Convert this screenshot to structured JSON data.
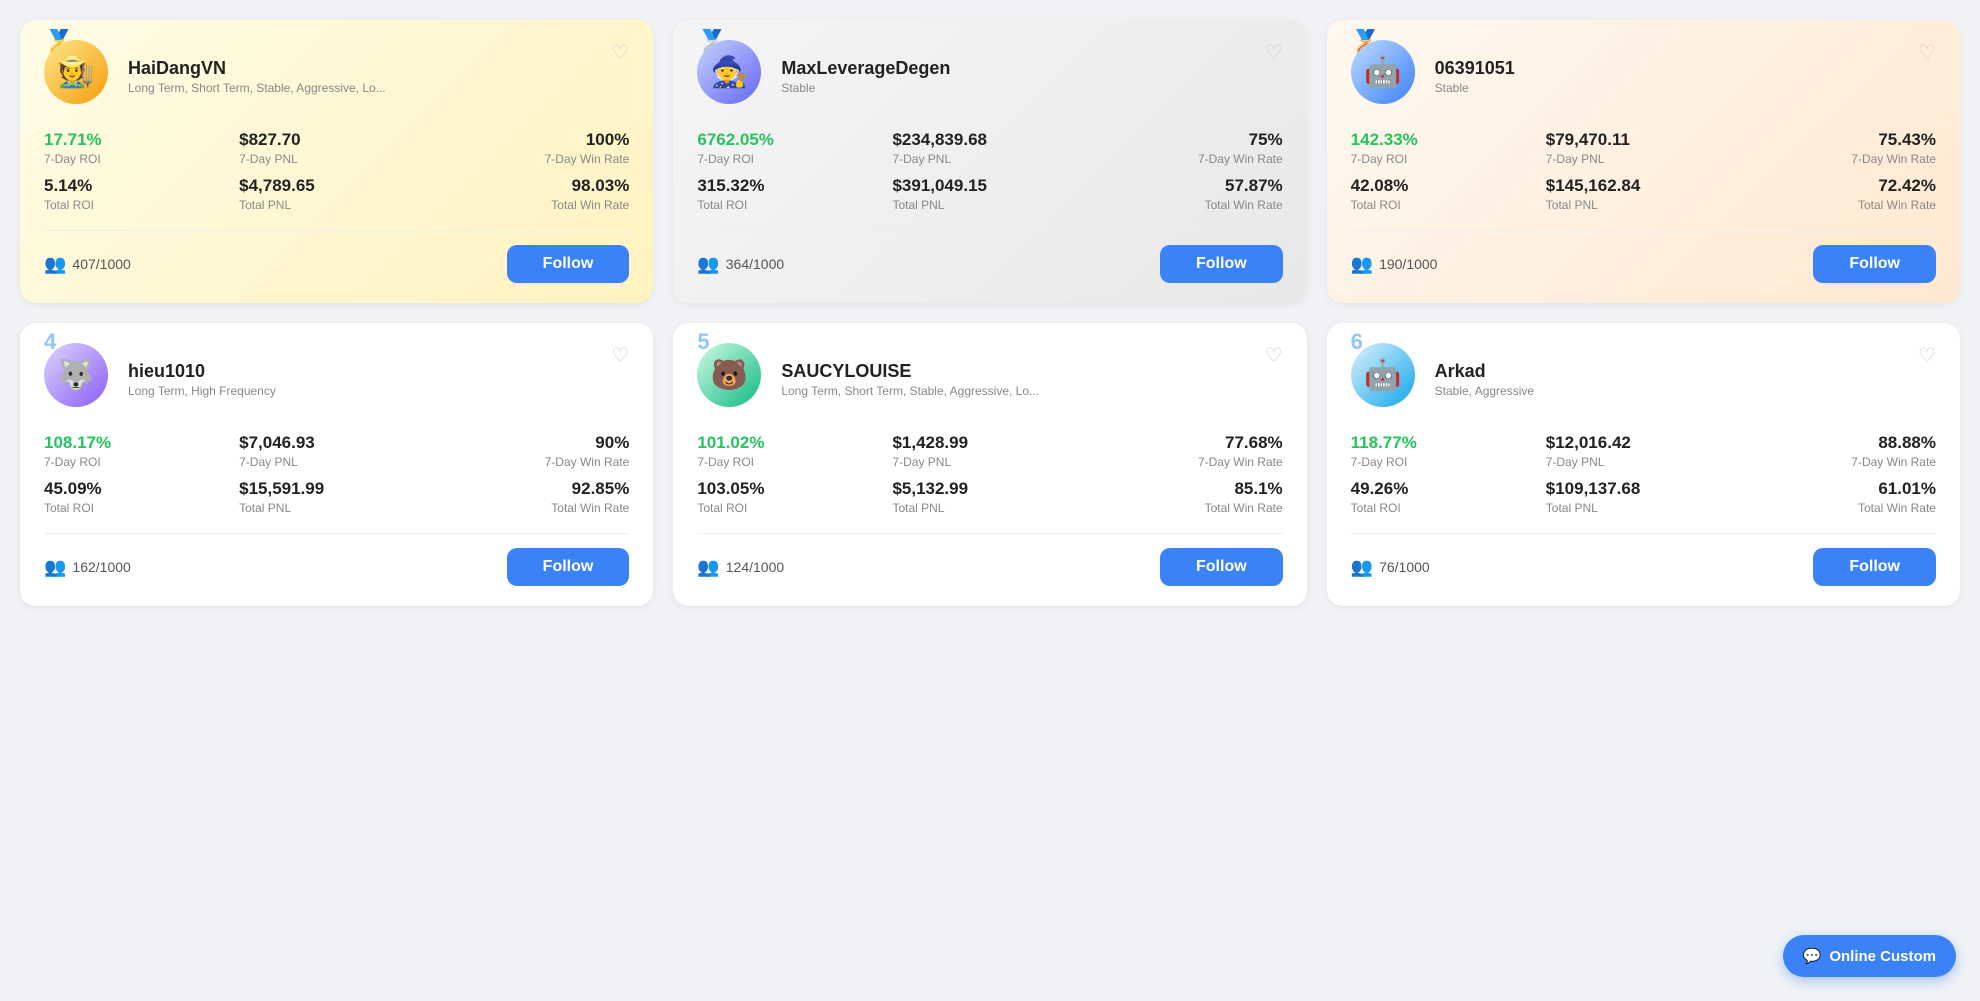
{
  "traders": [
    {
      "rank": 1,
      "medal": "🥇",
      "medalClass": "medal-gold",
      "rankClass": "rank1",
      "avatarClass": "av1",
      "avatarEmoji": "🧑‍🌾",
      "name": "HaiDangVN",
      "tags": "Long Term, Short Term, Stable, Aggressive, Lo...",
      "roi7d": "17.71%",
      "pnl7d": "$827.70",
      "wr7d": "100%",
      "roiTotal": "5.14%",
      "pnlTotal": "$4,789.65",
      "wrTotal": "98.03%",
      "followers": "407/1000",
      "followLabel": "Follow"
    },
    {
      "rank": 2,
      "medal": "🥈",
      "medalClass": "medal-silver",
      "rankClass": "rank2",
      "avatarClass": "av2",
      "avatarEmoji": "🧙",
      "name": "MaxLeverageDegen",
      "tags": "Stable",
      "roi7d": "6762.05%",
      "pnl7d": "$234,839.68",
      "wr7d": "75%",
      "roiTotal": "315.32%",
      "pnlTotal": "$391,049.15",
      "wrTotal": "57.87%",
      "followers": "364/1000",
      "followLabel": "Follow"
    },
    {
      "rank": 3,
      "medal": "🥉",
      "medalClass": "medal-bronze",
      "rankClass": "rank3",
      "avatarClass": "av3",
      "avatarEmoji": "🤖",
      "name": "06391051",
      "tags": "Stable",
      "roi7d": "142.33%",
      "pnl7d": "$79,470.11",
      "wr7d": "75.43%",
      "roiTotal": "42.08%",
      "pnlTotal": "$145,162.84",
      "wrTotal": "72.42%",
      "followers": "190/1000",
      "followLabel": "Follow"
    },
    {
      "rank": 4,
      "medal": "4",
      "medalClass": "rank-num-blue",
      "rankClass": "rank4",
      "avatarClass": "av4",
      "avatarEmoji": "🐺",
      "name": "hieu1010",
      "tags": "Long Term, High Frequency",
      "roi7d": "108.17%",
      "pnl7d": "$7,046.93",
      "wr7d": "90%",
      "roiTotal": "45.09%",
      "pnlTotal": "$15,591.99",
      "wrTotal": "92.85%",
      "followers": "162/1000",
      "followLabel": "Follow"
    },
    {
      "rank": 5,
      "medal": "5",
      "medalClass": "rank-num-blue",
      "rankClass": "rank5",
      "avatarClass": "av5",
      "avatarEmoji": "🐻",
      "name": "SAUCYLOUISE",
      "tags": "Long Term, Short Term, Stable, Aggressive, Lo...",
      "roi7d": "101.02%",
      "pnl7d": "$1,428.99",
      "wr7d": "77.68%",
      "roiTotal": "103.05%",
      "pnlTotal": "$5,132.99",
      "wrTotal": "85.1%",
      "followers": "124/1000",
      "followLabel": "Follow"
    },
    {
      "rank": 6,
      "medal": "6",
      "medalClass": "rank-num-blue",
      "rankClass": "rank6",
      "avatarClass": "av6",
      "avatarEmoji": "🤖",
      "name": "Arkad",
      "tags": "Stable, Aggressive",
      "roi7d": "118.77%",
      "pnl7d": "$12,016.42",
      "wr7d": "88.88%",
      "roiTotal": "49.26%",
      "pnlTotal": "$109,137.68",
      "wrTotal": "61.01%",
      "followers": "76/1000",
      "followLabel": "Follow"
    }
  ],
  "labels": {
    "roi7d": "7-Day ROI",
    "pnl7d": "7-Day PNL",
    "wr7d": "7-Day Win Rate",
    "roiTotal": "Total ROI",
    "pnlTotal": "Total PNL",
    "wrTotal": "Total Win Rate"
  },
  "onlineCustom": {
    "label": "Online Custom",
    "icon": "💬"
  }
}
